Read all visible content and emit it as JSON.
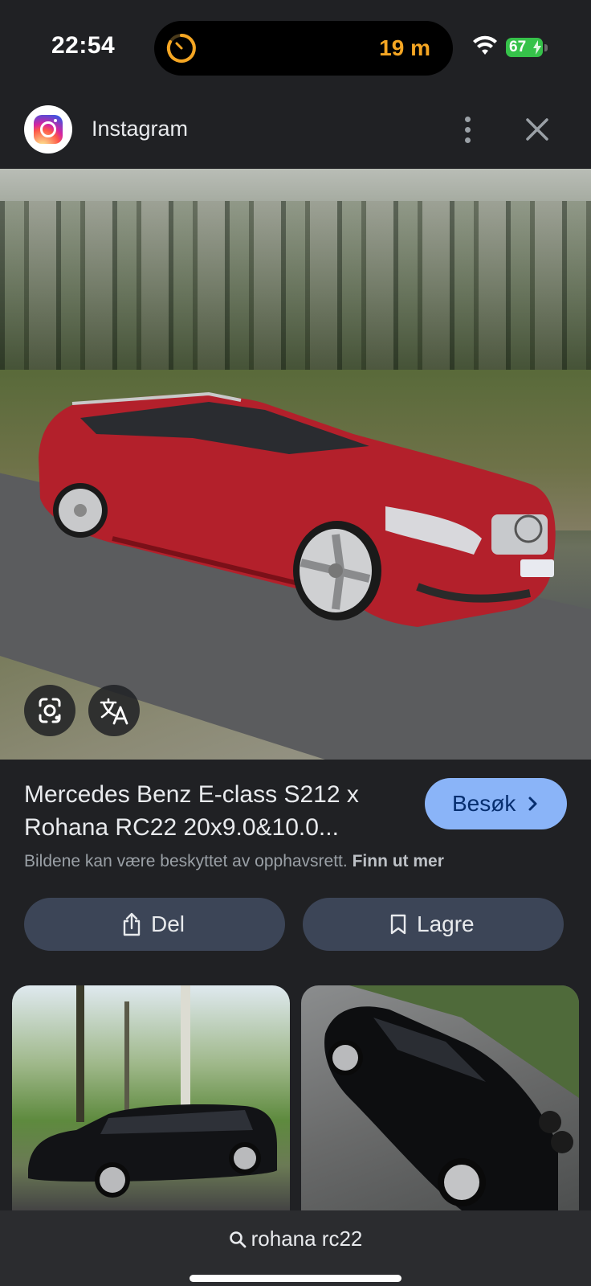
{
  "status_bar": {
    "time": "22:54",
    "timer_text": "19 m",
    "battery": "67",
    "colors": {
      "timer": "#f5a623",
      "battery": "#36c24a"
    }
  },
  "source": {
    "name": "Instagram",
    "icon": "instagram-logo-icon"
  },
  "result": {
    "title": "Mercedes Benz E-class S212 x Rohana RC22 20x9.0&10.0...",
    "visit_label": "Besøk",
    "copyright_text": "Bildene kan være beskyttet av opphavsrett.",
    "learn_more": "Finn ut mer"
  },
  "actions": {
    "share_label": "Del",
    "save_label": "Lagre"
  },
  "search": {
    "query": "rohana rc22"
  },
  "theme": {
    "accent": "#8ab4f8",
    "background": "#202124",
    "button_bg": "#3c4557"
  }
}
